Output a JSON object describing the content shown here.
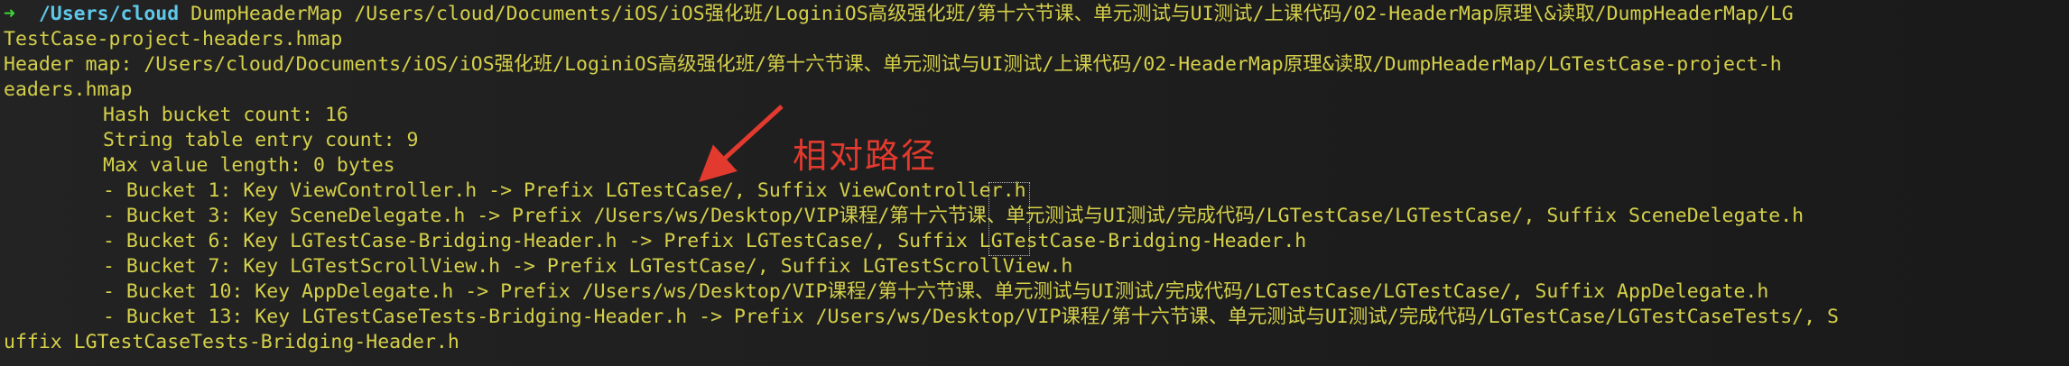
{
  "terminal": {
    "prompt_symbol": "➜",
    "cwd": "/Users/cloud",
    "command_line_1": "DumpHeaderMap /Users/cloud/Documents/iOS/iOS强化班/LoginiOS高级强化班/第十六节课、单元测试与UI测试/上课代码/02-HeaderMap原理\\&读取/DumpHeaderMap/LG",
    "command_line_2": "TestCase-project-headers.hmap",
    "output": [
      "Header map: /Users/cloud/Documents/iOS/iOS强化班/LoginiOS高级强化班/第十六节课、单元测试与UI测试/上课代码/02-HeaderMap原理&读取/DumpHeaderMap/LGTestCase-project-h",
      "eaders.hmap",
      "Hash bucket count: 16",
      "String table entry count: 9",
      "Max value length: 0 bytes",
      "- Bucket 1: Key ViewController.h -> Prefix LGTestCase/, Suffix ViewController.h",
      "- Bucket 3: Key SceneDelegate.h -> Prefix /Users/ws/Desktop/VIP课程/第十六节课、单元测试与UI测试/完成代码/LGTestCase/LGTestCase/, Suffix SceneDelegate.h",
      "- Bucket 6: Key LGTestCase-Bridging-Header.h -> Prefix LGTestCase/, Suffix LGTestCase-Bridging-Header.h",
      "- Bucket 7: Key LGTestScrollView.h -> Prefix LGTestCase/, Suffix LGTestScrollView.h",
      "- Bucket 10: Key AppDelegate.h -> Prefix /Users/ws/Desktop/VIP课程/第十六节课、单元测试与UI测试/完成代码/LGTestCase/LGTestCase/, Suffix AppDelegate.h",
      "- Bucket 13: Key LGTestCaseTests-Bridging-Header.h -> Prefix /Users/ws/Desktop/VIP课程/第十六节课、单元测试与UI测试/完成代码/LGTestCase/LGTestCaseTests/, S",
      "uffix LGTestCaseTests-Bridging-Header.h"
    ]
  },
  "annotation": {
    "text": "相对路径",
    "color": "#e23a2e"
  },
  "colors": {
    "background": "#1b1b1b",
    "text": "#d5d04a",
    "prompt": "#3ed43a",
    "cwd": "#5fc7e8"
  }
}
